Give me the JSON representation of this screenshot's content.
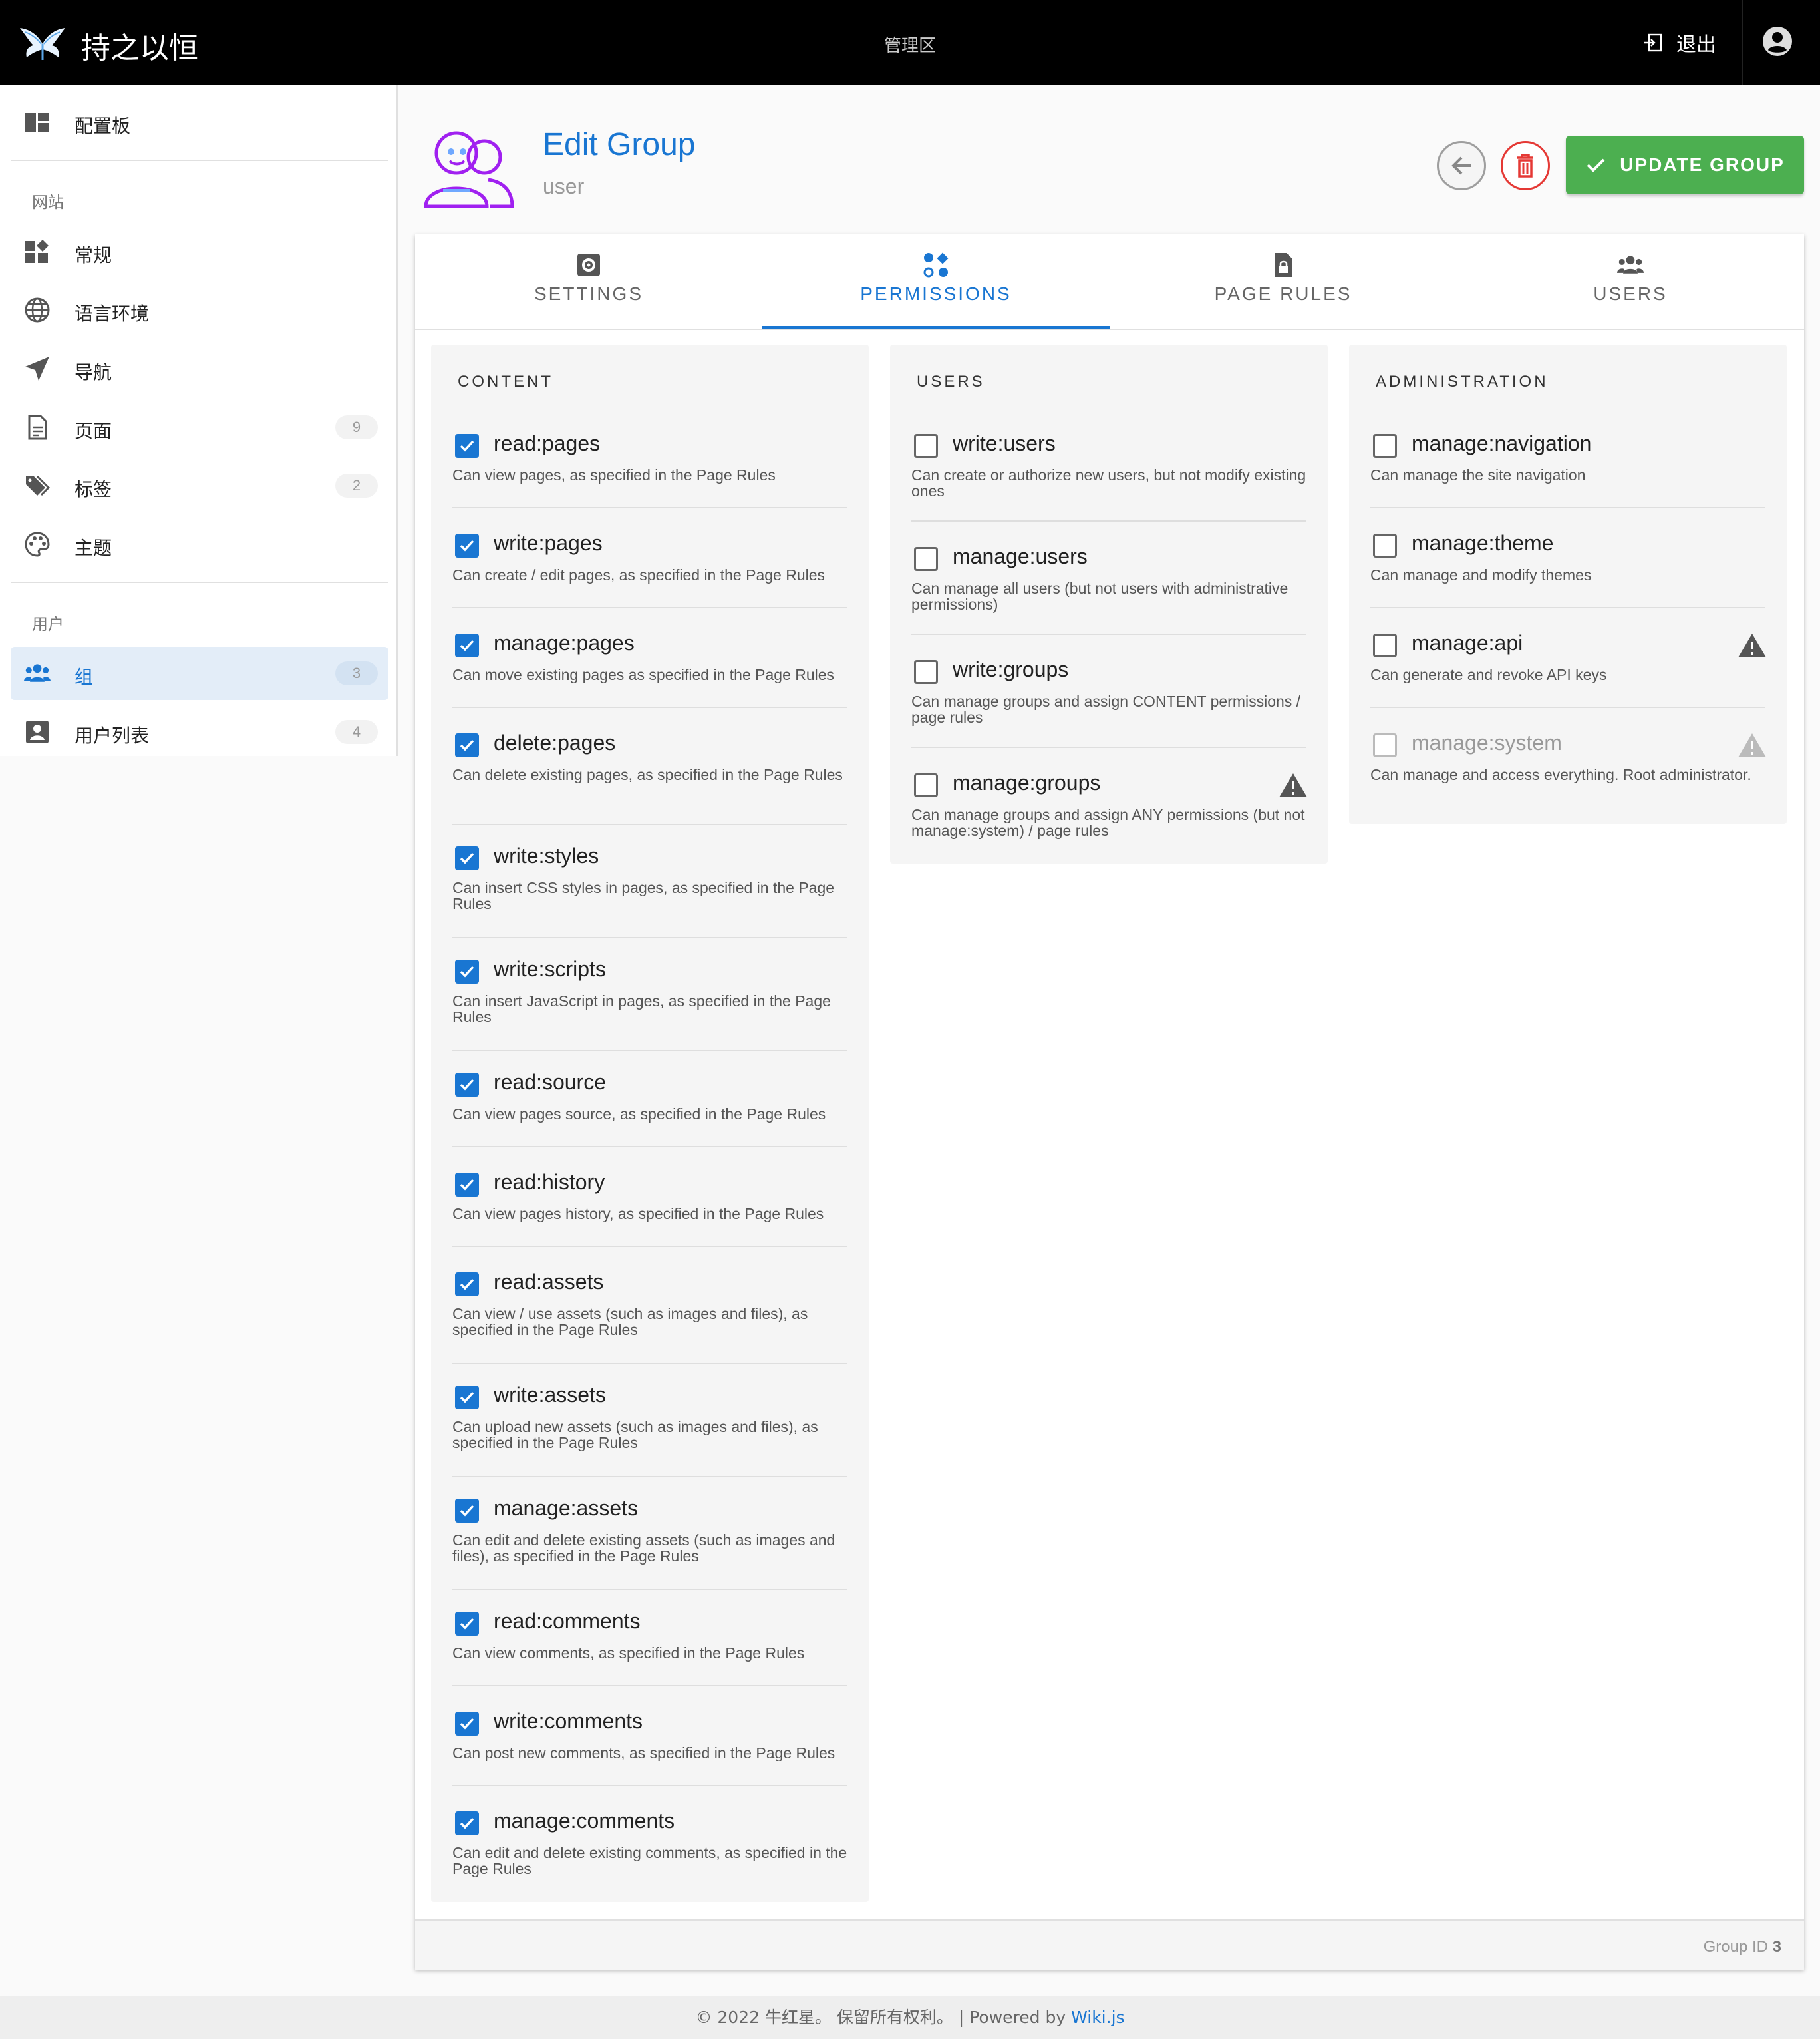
{
  "topbar": {
    "site_title": "持之以恒",
    "admin_label": "管理区",
    "logout_label": "退出"
  },
  "sidebar": {
    "items": [
      {
        "label": "配置板",
        "icon": "dashboard-icon"
      },
      {
        "label": "常规",
        "icon": "widgets-icon"
      },
      {
        "label": "语言环境",
        "icon": "globe-icon"
      },
      {
        "label": "导航",
        "icon": "send-icon"
      },
      {
        "label": "页面",
        "icon": "document-icon",
        "count": "9"
      },
      {
        "label": "标签",
        "icon": "tags-icon",
        "count": "2"
      },
      {
        "label": "主题",
        "icon": "palette-icon"
      },
      {
        "label": "组",
        "icon": "groups-icon",
        "count": "3",
        "active": true
      },
      {
        "label": "用户列表",
        "icon": "account-box-icon",
        "count": "4"
      }
    ],
    "section_site": "网站",
    "section_users": "用户"
  },
  "header": {
    "title": "Edit Group",
    "subtitle": "user",
    "update_label": "UPDATE GROUP"
  },
  "tabs": [
    {
      "label": "SETTINGS",
      "icon": "settings-box-icon"
    },
    {
      "label": "PERMISSIONS",
      "icon": "permissions-icon",
      "active": true
    },
    {
      "label": "PAGE RULES",
      "icon": "file-lock-icon"
    },
    {
      "label": "USERS",
      "icon": "users-icon"
    }
  ],
  "permissions": {
    "content": {
      "title": "CONTENT",
      "items": [
        {
          "name": "read:pages",
          "desc": "Can view pages, as specified in the Page Rules",
          "checked": true
        },
        {
          "name": "write:pages",
          "desc": "Can create / edit pages, as specified in the Page Rules",
          "checked": true
        },
        {
          "name": "manage:pages",
          "desc": "Can move existing pages as specified in the Page Rules",
          "checked": true
        },
        {
          "name": "delete:pages",
          "desc": "Can delete existing pages, as specified in the Page Rules",
          "checked": true
        },
        {
          "name": "write:styles",
          "desc": "Can insert CSS styles in pages, as specified in the Page Rules",
          "checked": true
        },
        {
          "name": "write:scripts",
          "desc": "Can insert JavaScript in pages, as specified in the Page Rules",
          "checked": true
        },
        {
          "name": "read:source",
          "desc": "Can view pages source, as specified in the Page Rules",
          "checked": true
        },
        {
          "name": "read:history",
          "desc": "Can view pages history, as specified in the Page Rules",
          "checked": true
        },
        {
          "name": "read:assets",
          "desc": "Can view / use assets (such as images and files), as specified in the Page Rules",
          "checked": true
        },
        {
          "name": "write:assets",
          "desc": "Can upload new assets (such as images and files), as specified in the Page Rules",
          "checked": true
        },
        {
          "name": "manage:assets",
          "desc": "Can edit and delete existing assets (such as images and files), as specified in the Page Rules",
          "checked": true
        },
        {
          "name": "read:comments",
          "desc": "Can view comments, as specified in the Page Rules",
          "checked": true
        },
        {
          "name": "write:comments",
          "desc": "Can post new comments, as specified in the Page Rules",
          "checked": true
        },
        {
          "name": "manage:comments",
          "desc": "Can edit and delete existing comments, as specified in the Page Rules",
          "checked": true
        }
      ]
    },
    "users": {
      "title": "USERS",
      "items": [
        {
          "name": "write:users",
          "desc": "Can create or authorize new users, but not modify existing ones",
          "checked": false
        },
        {
          "name": "manage:users",
          "desc": "Can manage all users (but not users with administrative permissions)",
          "checked": false
        },
        {
          "name": "write:groups",
          "desc": "Can manage groups and assign CONTENT permissions / page rules",
          "checked": false
        },
        {
          "name": "manage:groups",
          "desc": "Can manage groups and assign ANY permissions (but not manage:system) / page rules",
          "checked": false,
          "warning": true
        }
      ]
    },
    "administration": {
      "title": "ADMINISTRATION",
      "items": [
        {
          "name": "manage:navigation",
          "desc": "Can manage the site navigation",
          "checked": false
        },
        {
          "name": "manage:theme",
          "desc": "Can manage and modify themes",
          "checked": false
        },
        {
          "name": "manage:api",
          "desc": "Can generate and revoke API keys",
          "checked": false,
          "warning": true
        },
        {
          "name": "manage:system",
          "desc": "Can manage and access everything. Root administrator.",
          "checked": false,
          "disabled": true,
          "warning": true
        }
      ]
    }
  },
  "card_footer": {
    "group_id_label": "Group ID",
    "group_id": "3"
  },
  "page_footer": {
    "copyright": "© 2022 牛红星。 保留所有权利。 | Powered by",
    "powered_link": "Wiki.js"
  },
  "colors": {
    "accent": "#1976d2",
    "update_button": "#4caf50",
    "delete_button": "#e53935",
    "avatar_purple": "#a020f0"
  }
}
